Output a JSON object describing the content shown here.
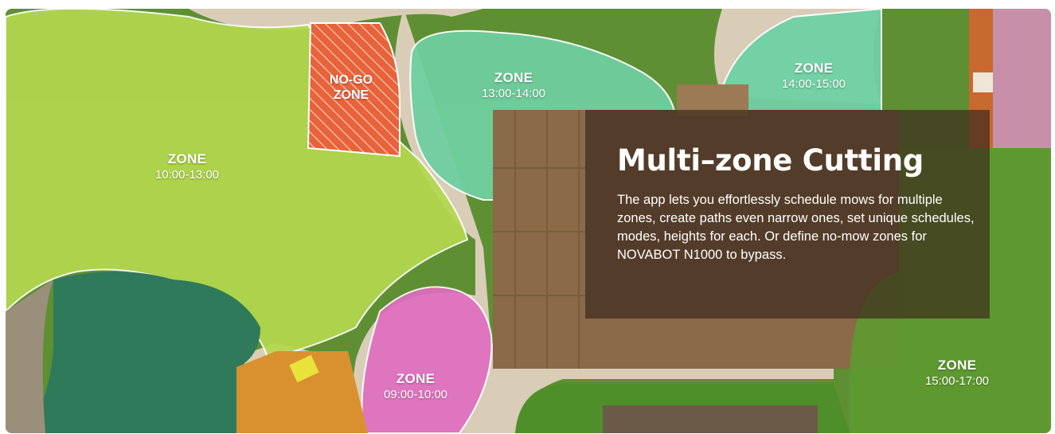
{
  "feature": {
    "title": "Multi–zone Cutting",
    "description": "The app lets you effortlessly schedule mows for multiple zones, create paths even narrow ones, set unique schedules, modes,  heights for each. Or define no-mow zones for NOVABOT N1000 to bypass."
  },
  "zones": [
    {
      "name": "ZONE",
      "time": "10:00-13:00",
      "color": "#b4d84e"
    },
    {
      "name": "ZONE",
      "time": "13:00-14:00",
      "color": "#6fcfa0"
    },
    {
      "name": "ZONE",
      "time": "14:00-15:00",
      "color": "#6fd0a4"
    },
    {
      "name": "ZONE",
      "time": "09:00-10:00",
      "color": "#e06cc0"
    },
    {
      "name": "ZONE",
      "time": "15:00-17:00",
      "color": "#5e9a30"
    }
  ],
  "no_go_zone": {
    "line1": "NO-GO",
    "line2": "ZONE",
    "color": "#e8623a"
  },
  "colors": {
    "panel": "#3c2a1c",
    "path": "#d9cdb8",
    "roof": "#8a6a48",
    "deck": "#d9912f",
    "pond": "#2f7a5a"
  }
}
